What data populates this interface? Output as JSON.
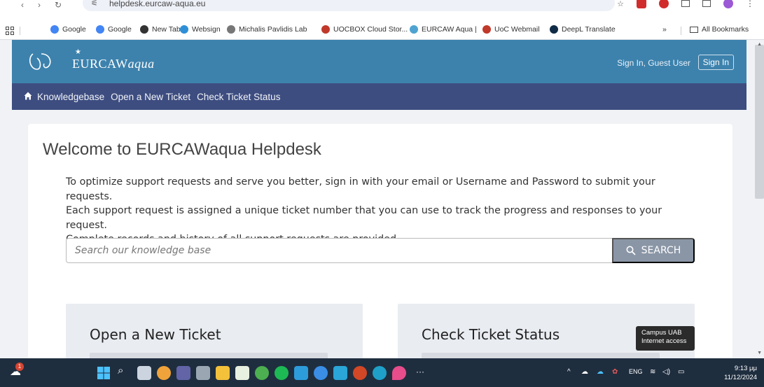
{
  "browser": {
    "url": "helpdesk.eurcaw-aqua.eu",
    "bookmarks": [
      {
        "label": "Google",
        "color": "#4285f4"
      },
      {
        "label": "Google",
        "color": "#4285f4"
      },
      {
        "label": "New Tab",
        "color": "#333333"
      },
      {
        "label": "Websign",
        "color": "#2f8fd6"
      },
      {
        "label": "Michalis Pavlidis Lab",
        "color": "#777777"
      },
      {
        "label": "UOCBOX Cloud Stor...",
        "color": "#c0392b"
      },
      {
        "label": "EURCAW Aqua |",
        "color": "#4fa3d1"
      },
      {
        "label": "UoC Webmail",
        "color": "#c0392b"
      },
      {
        "label": "DeepL Translate",
        "color": "#0f2b46"
      }
    ],
    "overflow": "»",
    "all_bookmarks": "All Bookmarks"
  },
  "site": {
    "logo_text_main": "EURCAW",
    "logo_text_italic": "aqua",
    "signed_in_as": "Sign In, Guest User",
    "sign_in_button": "Sign In",
    "nav": [
      "Knowledgebase",
      "Open a New Ticket",
      "Check Ticket Status"
    ],
    "brand_color": "#3d82ad",
    "nav_color": "#3d4d80"
  },
  "main": {
    "title": "Welcome to EURCAWaqua Helpdesk",
    "intro_lines": [
      "To optimize support requests and serve you better, sign in with your email or Username and Password to submit your requests.",
      "Each support request is assigned a unique ticket number that you can use to track the progress and responses to your request.",
      "Complete records and history of all support requests are provided."
    ],
    "search_placeholder": "Search our knowledge base",
    "search_button": "SEARCH",
    "panels": [
      "Open a New Ticket",
      "Check Ticket Status"
    ]
  },
  "tooltip": {
    "line1": "Campus UAB",
    "line2": "Internet access"
  },
  "taskbar": {
    "notification_count": "1",
    "language": "ENG",
    "time": "9:13 μμ",
    "date": "11/12/2024"
  }
}
